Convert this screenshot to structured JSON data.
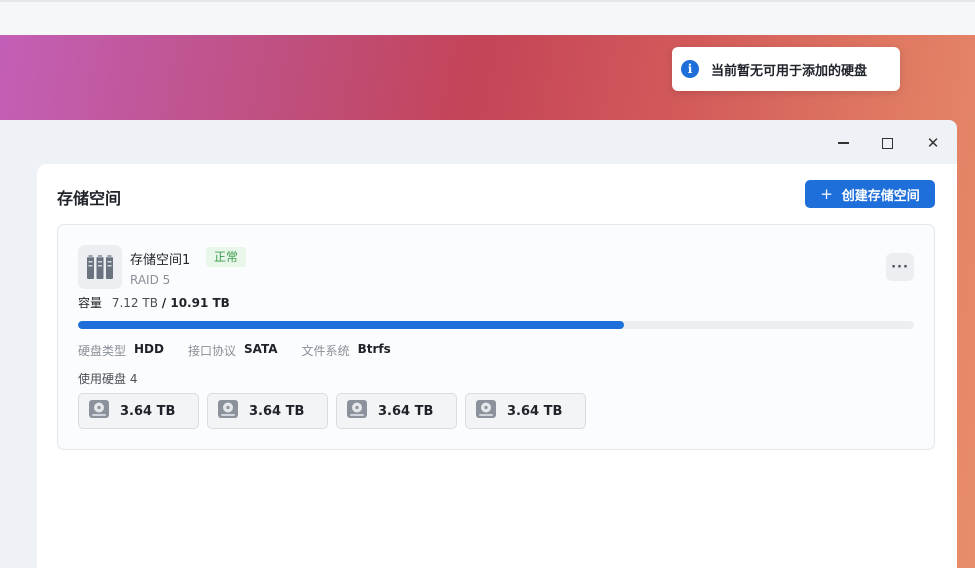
{
  "toast": {
    "message": "当前暂无可用于添加的硬盘",
    "icon": "info-icon"
  },
  "window": {
    "controls": [
      "minimize-icon",
      "maximize-icon",
      "close-icon"
    ]
  },
  "page": {
    "title": "存储空间",
    "create_button_label": "创建存储空间"
  },
  "volume": {
    "name": "存储空间1",
    "status": "正常",
    "raid": "RAID 5",
    "capacity_label": "容量",
    "used": "7.12 TB",
    "total": "/ 10.91 TB",
    "used_fraction": 0.6526,
    "props": {
      "disk_type_label": "硬盘类型",
      "disk_type": "HDD",
      "interface_label": "接口协议",
      "interface": "SATA",
      "fs_label": "文件系统",
      "fs": "Btrfs"
    },
    "disks_label": "使用硬盘 4",
    "disks": [
      {
        "size": "3.64 TB"
      },
      {
        "size": "3.64 TB"
      },
      {
        "size": "3.64 TB"
      },
      {
        "size": "3.64 TB"
      }
    ]
  },
  "colors": {
    "accent": "#1e6fd9",
    "status_ok": "#3c9e4e"
  }
}
